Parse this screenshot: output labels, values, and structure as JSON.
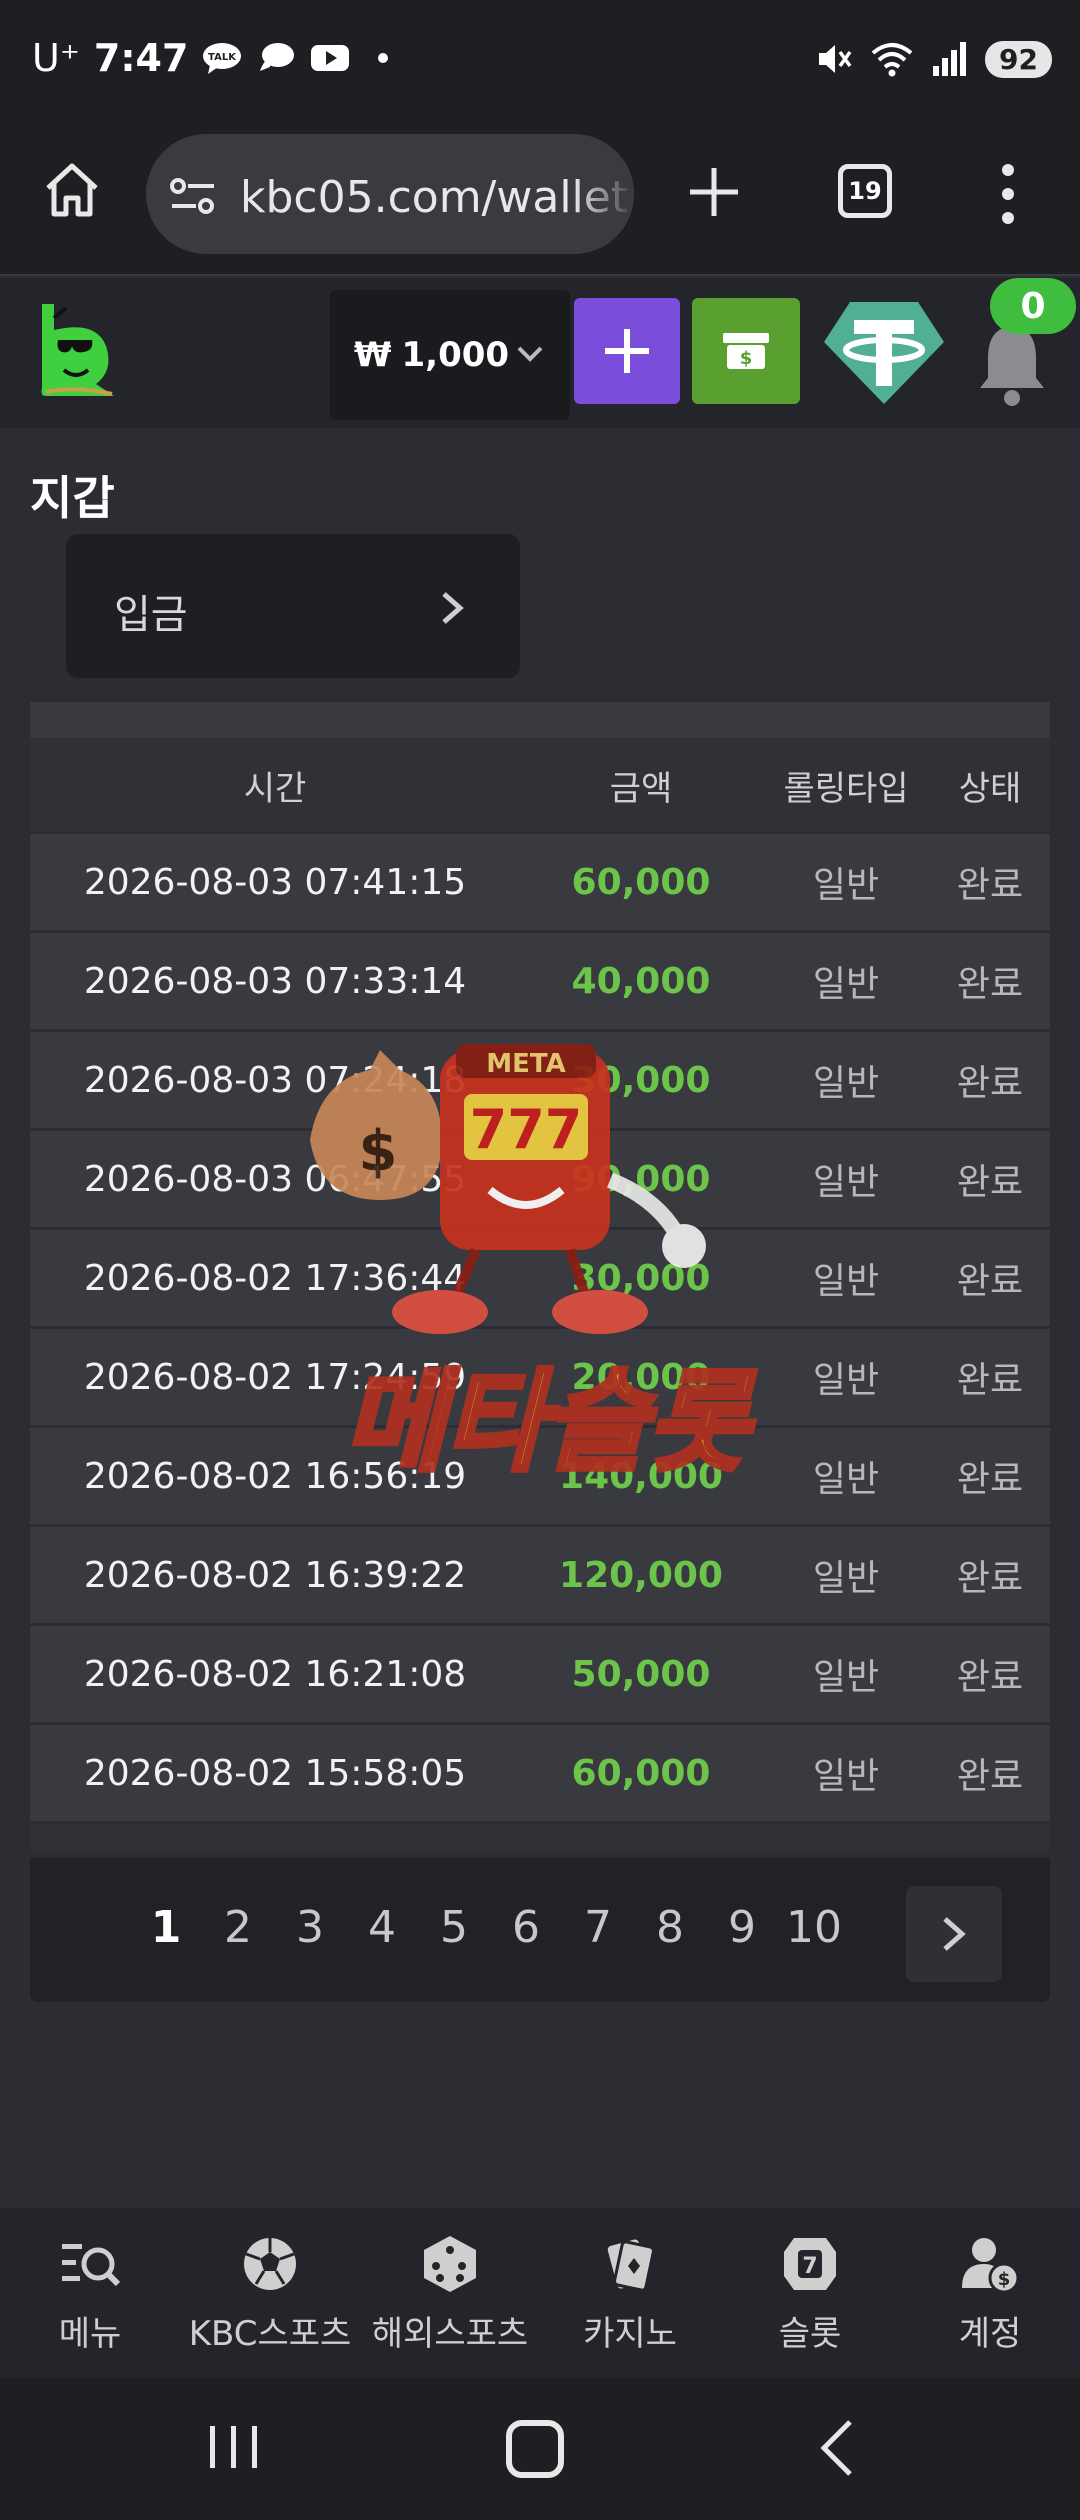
{
  "status_bar": {
    "carrier": "U⁺",
    "time": "7:47",
    "battery": "92",
    "icons": [
      "talk-icon",
      "message-icon",
      "youtube-icon",
      "mute-icon",
      "wifi-icon",
      "signal-icon"
    ]
  },
  "browser": {
    "url": "kbc05.com/wallet",
    "tab_count": "19"
  },
  "header": {
    "currency_symbol": "₩",
    "balance": "1,000",
    "notification_count": "0"
  },
  "page": {
    "title": "지갑",
    "tab_label": "입금"
  },
  "table": {
    "headers": [
      "시간",
      "금액",
      "롤링타입",
      "상태"
    ],
    "rows": [
      {
        "time": "2026-08-03 07:41:15",
        "amount": "60,000",
        "rolling": "일반",
        "status": "완료"
      },
      {
        "time": "2026-08-03 07:33:14",
        "amount": "40,000",
        "rolling": "일반",
        "status": "완료"
      },
      {
        "time": "2026-08-03 07:24:18",
        "amount": "30,000",
        "rolling": "일반",
        "status": "완료"
      },
      {
        "time": "2026-08-03 06:47:55",
        "amount": "90,000",
        "rolling": "일반",
        "status": "완료"
      },
      {
        "time": "2026-08-02 17:36:44",
        "amount": "30,000",
        "rolling": "일반",
        "status": "완료"
      },
      {
        "time": "2026-08-02 17:24:59",
        "amount": "20,000",
        "rolling": "일반",
        "status": "완료"
      },
      {
        "time": "2026-08-02 16:56:19",
        "amount": "140,000",
        "rolling": "일반",
        "status": "완료"
      },
      {
        "time": "2026-08-02 16:39:22",
        "amount": "120,000",
        "rolling": "일반",
        "status": "완료"
      },
      {
        "time": "2026-08-02 16:21:08",
        "amount": "50,000",
        "rolling": "일반",
        "status": "완료"
      },
      {
        "time": "2026-08-02 15:58:05",
        "amount": "60,000",
        "rolling": "일반",
        "status": "완료"
      }
    ]
  },
  "pagination": {
    "pages": [
      "1",
      "2",
      "3",
      "4",
      "5",
      "6",
      "7",
      "8",
      "9",
      "10"
    ],
    "current": "1"
  },
  "watermark": {
    "sign_text": "META",
    "reels": "777",
    "brand_text": "메타슬롯"
  },
  "bottom_nav": [
    {
      "label": "메뉴",
      "icon": "menu-search-icon"
    },
    {
      "label": "KBC스포츠",
      "icon": "soccer-ball-icon"
    },
    {
      "label": "해외스포츠",
      "icon": "dice-icon"
    },
    {
      "label": "카지노",
      "icon": "cards-icon"
    },
    {
      "label": "슬롯",
      "icon": "slot-icon"
    },
    {
      "label": "계정",
      "icon": "account-icon"
    }
  ],
  "colors": {
    "amount_green": "#6cc44a",
    "plus_purple": "#7b4ddb",
    "cash_green": "#5aa030",
    "tether_teal": "#50af95",
    "badge_green": "#3fbd3f"
  }
}
